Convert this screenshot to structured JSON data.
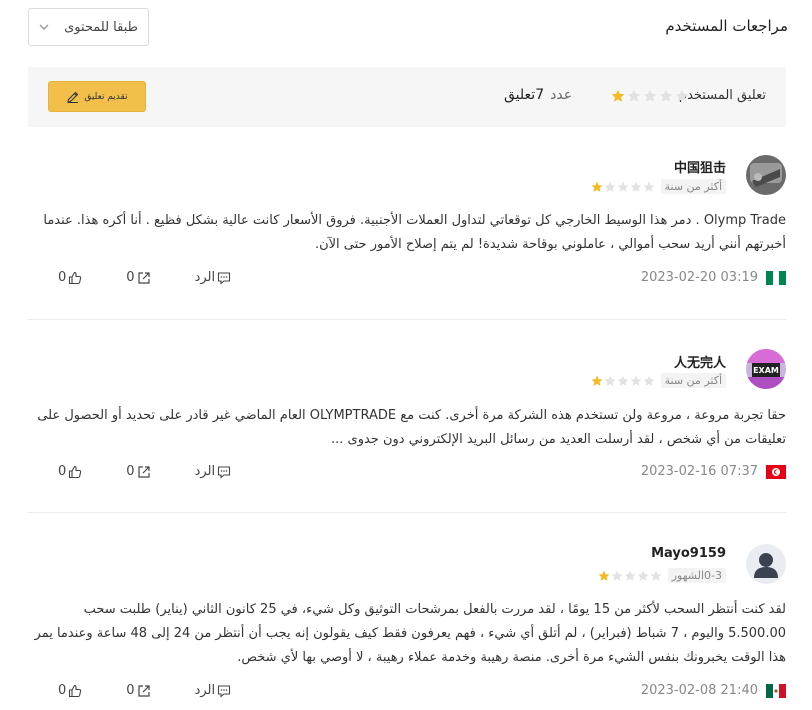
{
  "header": {
    "title": "مراجعات المستخدم",
    "sort": "طبقا للمحتوى"
  },
  "summary": {
    "title": "تعليق المستخدم",
    "rating": 1,
    "max_rating": 5,
    "count_label": "عدد",
    "count_value": "7تعليق",
    "submit_label": "تقديم تعليق"
  },
  "colors": {
    "star_on": "#f5b923",
    "star_off": "#e2e2e2",
    "button": "#f2c04a"
  },
  "reviews": [
    {
      "username": "中国狙击",
      "age": "أكثر من سنة",
      "rating": 1,
      "text": "Olymp Trade . دمر هذا الوسيط الخارجي كل توقعاتي لتداول العملات الأجنبية. فروق الأسعار كانت عالية بشكل فظيع . أنا أكره هذا. عندما أخبرتهم أنني أريد سحب أموالي ، عاملوني بوقاحة شديدة! لم يتم إصلاح الأمور حتى الآن.",
      "date": "2023-02-20 03:19",
      "flag": "nigeria",
      "reply_label": "الرد",
      "share_count": "0",
      "like_count": "0"
    },
    {
      "username": "人无完人",
      "age": "أكثر من سنة",
      "rating": 1,
      "text": "حقا تجربة مروعة ، مروعة ولن تستخدم هذه الشركة مرة أخرى. كنت مع OLYMPTRADE العام الماضي غير قادر على تحديد أو الحصول على تعليقات من أي شخص ، لقد أرسلت العديد من رسائل البريد الإلكتروني دون جدوى ...",
      "date": "2023-02-16 07:37",
      "flag": "tunisia",
      "reply_label": "الرد",
      "share_count": "0",
      "like_count": "0"
    },
    {
      "username": "Mayo9159",
      "age": "0-3الشهور",
      "rating": 1,
      "text": "لقد كنت أنتظر السحب لأكثر من 15 يومًا ، لقد مررت بالفعل بمرشحات التوثيق وكل شيء، في 25 كانون الثاني (يناير) طلبت سحب 5.500.00 واليوم ، 7 شباط (فبراير) ، لم أتلق أي شيء ، فهم يعرفون فقط كيف يقولون إنه يجب أن أنتظر من 24 إلى 48 ساعة وعندما يمر هذا الوقت يخبرونك بنفس الشيء مرة أخرى. منصة رهيبة وخدمة عملاء رهيبة ، لا أوصي بها لأي شخص.",
      "date": "2023-02-08 21:40",
      "flag": "mexico",
      "reply_label": "الرد",
      "share_count": "0",
      "like_count": "0"
    }
  ]
}
